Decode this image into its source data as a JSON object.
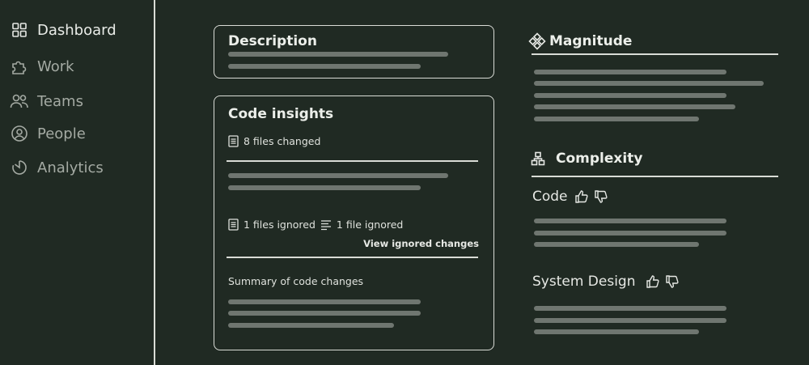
{
  "sidebar": {
    "items": [
      {
        "label": "Dashboard",
        "icon": "grid-icon",
        "state": "active"
      },
      {
        "label": "Work",
        "icon": "puzzle-icon",
        "state": "muted"
      },
      {
        "label": "Teams",
        "icon": "users-icon",
        "state": "muted"
      },
      {
        "label": "People",
        "icon": "user-circle-icon",
        "state": "muted"
      },
      {
        "label": "Analytics",
        "icon": "analytics-icon",
        "state": "muted"
      }
    ]
  },
  "description": {
    "title": "Description"
  },
  "code_insights": {
    "title": "Code insights",
    "files_changed": "8 files changed",
    "files_ignored": "1 files ignored",
    "file_ignored": "1 file ignored",
    "view_ignored": "View ignored changes",
    "summary_label": "Summary of code changes"
  },
  "magnitude": {
    "title": "Magnitude"
  },
  "complexity": {
    "title": "Complexity",
    "code_label": "Code",
    "system_design_label": "System Design"
  },
  "colors": {
    "background": "#202a23",
    "border": "#d9dcd6",
    "placeholder": "#6f7670",
    "text": "#e6e8e4"
  }
}
